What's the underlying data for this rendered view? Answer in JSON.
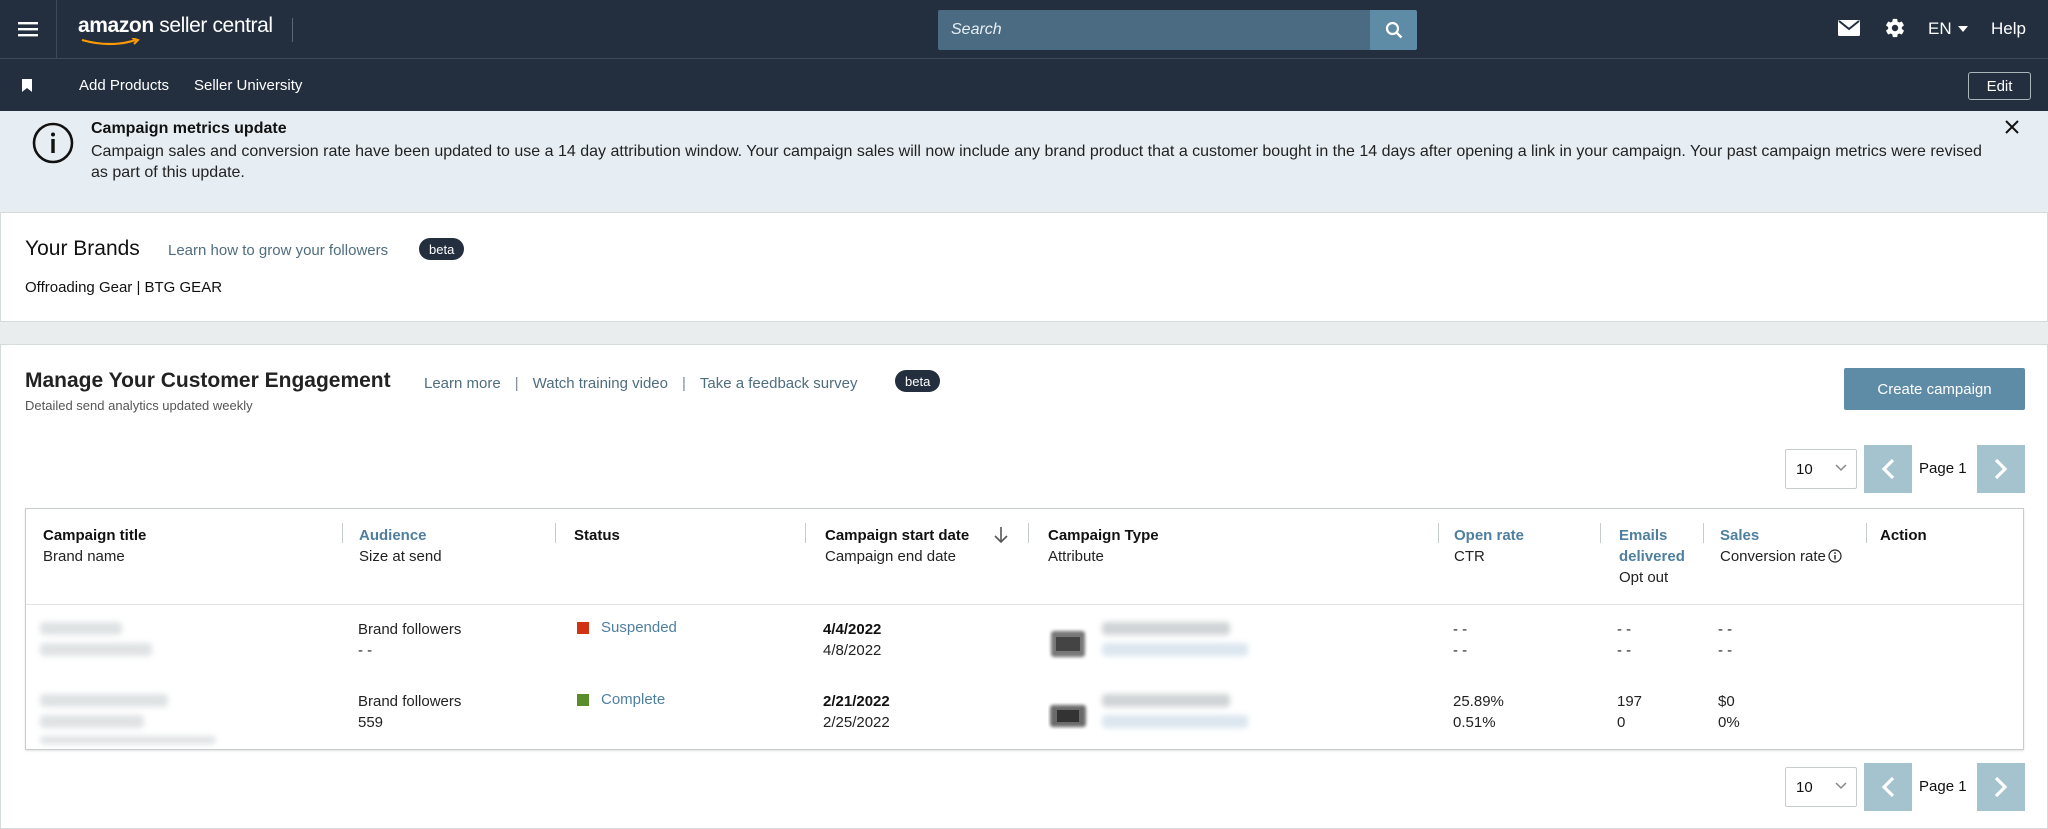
{
  "header": {
    "logo_brand": "amazon",
    "logo_rest": " seller central",
    "search_placeholder": "Search",
    "language": "EN",
    "help": "Help"
  },
  "subnav": {
    "items": [
      "Add Products",
      "Seller University"
    ],
    "edit": "Edit"
  },
  "notice": {
    "title": "Campaign metrics update",
    "body": "Campaign sales and conversion rate have been updated to use a 14 day attribution window. Your campaign sales will now include any brand product that a customer bought in the 14 days after opening a link in your campaign. Your past campaign metrics were revised as part of this update."
  },
  "brands": {
    "title": "Your Brands",
    "link": "Learn how to grow your followers",
    "badge": "beta",
    "names": "Offroading Gear | BTG GEAR"
  },
  "engagement": {
    "title": "Manage Your Customer Engagement",
    "links": [
      "Learn more",
      "Watch training video",
      "Take a feedback survey"
    ],
    "separator": "|",
    "badge": "beta",
    "subtitle": "Detailed send analytics updated weekly",
    "create_button": "Create campaign",
    "page_size": "10",
    "page_label": "Page 1"
  },
  "table": {
    "columns": [
      {
        "title": "Campaign title",
        "sub": "Brand name"
      },
      {
        "title": "Audience",
        "sub": "Size at send"
      },
      {
        "title": "Status",
        "sub": ""
      },
      {
        "title": "Campaign start date",
        "sub": "Campaign end date"
      },
      {
        "title": "Campaign Type",
        "sub": "Attribute"
      },
      {
        "title": "Open rate",
        "sub": "CTR"
      },
      {
        "title": "Emails delivered",
        "sub": "Opt out"
      },
      {
        "title": "Sales",
        "sub": "Conversion rate"
      },
      {
        "title": "Action",
        "sub": ""
      }
    ],
    "rows": [
      {
        "audience": "Brand followers",
        "size": "- -",
        "status": "Suspended",
        "status_color": "#d13212",
        "start": "4/4/2022",
        "end": "4/8/2022",
        "open_rate": "- -",
        "ctr": "- -",
        "emails": "- -",
        "opt_out": "- -",
        "sales": "- -",
        "conversion": "- -"
      },
      {
        "audience": "Brand followers",
        "size": "559",
        "status": "Complete",
        "status_color": "#5b8c2a",
        "start": "2/21/2022",
        "end": "2/25/2022",
        "open_rate": "25.89%",
        "ctr": "0.51%",
        "emails": "197",
        "opt_out": "0",
        "sales": "$0",
        "conversion": "0%"
      }
    ]
  },
  "colors": {
    "header_bg": "#232f3e",
    "notice_bg": "#e7eef3",
    "accent": "#5e8ba6",
    "link": "#4f7f9e",
    "pager_button": "#a5c3ce"
  }
}
